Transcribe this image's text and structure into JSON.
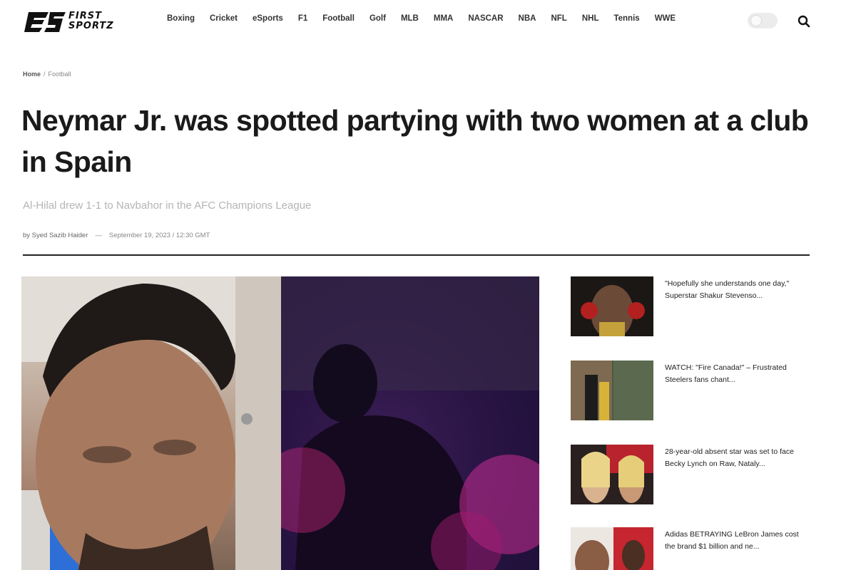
{
  "brand": {
    "line1": "FIRST",
    "line2": "SPORTZ"
  },
  "nav": [
    "Boxing",
    "Cricket",
    "eSports",
    "F1",
    "Football",
    "Golf",
    "MLB",
    "MMA",
    "NASCAR",
    "NBA",
    "NFL",
    "NHL",
    "Tennis",
    "WWE"
  ],
  "breadcrumb": {
    "home": "Home",
    "sep": "/",
    "current": "Football"
  },
  "article": {
    "title": "Neymar Jr. was spotted partying with two women at a club in Spain",
    "subtitle": "Al-Hilal drew 1-1 to Navbahor in the AFC Champions League",
    "author": "by Syed Sazib Haider",
    "dash": "—",
    "date": "September 19, 2023 / 12:30 GMT"
  },
  "sidebar": [
    {
      "headline": "\"Hopefully she understands one day,\" Superstar Shakur Stevenso..."
    },
    {
      "headline": "WATCH: \"Fire Canada!\" – Frustrated Steelers fans chant..."
    },
    {
      "headline": "28-year-old absent star was set to face Becky Lynch on Raw, Nataly..."
    },
    {
      "headline": "Adidas BETRAYING LeBron James cost the brand $1 billion and ne..."
    }
  ],
  "colors": {
    "text": "#1a1a1a",
    "nav": "#333333",
    "divider": "#222222",
    "subtitle": "#b4b4b4"
  }
}
